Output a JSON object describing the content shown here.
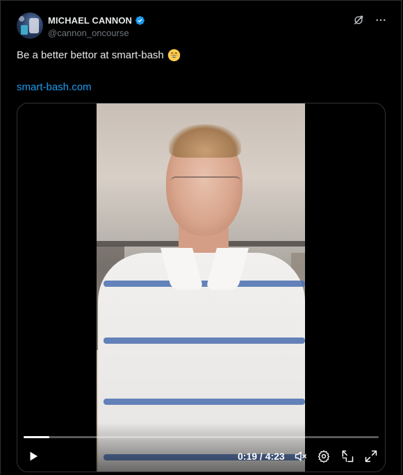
{
  "author": {
    "display_name": "MICHAEL CANNON",
    "handle": "@cannon_oncourse",
    "verified": true,
    "avatar_icon": "avatar-image"
  },
  "header_actions": {
    "grok_icon": "grok-icon",
    "more_icon": "more-options-icon"
  },
  "post": {
    "text": "Be a better bettor at smart-bash",
    "emoji": "grinning-face-emoji",
    "link": "smart-bash.com"
  },
  "video": {
    "time_display": "0:19 / 4:23",
    "progress_fraction": 0.073,
    "controls": [
      "play-icon",
      "mute-icon",
      "settings-icon",
      "pip-icon",
      "fullscreen-icon"
    ]
  },
  "colors": {
    "background": "#000000",
    "text": "#e7e9ea",
    "muted": "#71767b",
    "link": "#1d9bf0",
    "verified": "#1d9bf0",
    "border": "#2f3336"
  }
}
